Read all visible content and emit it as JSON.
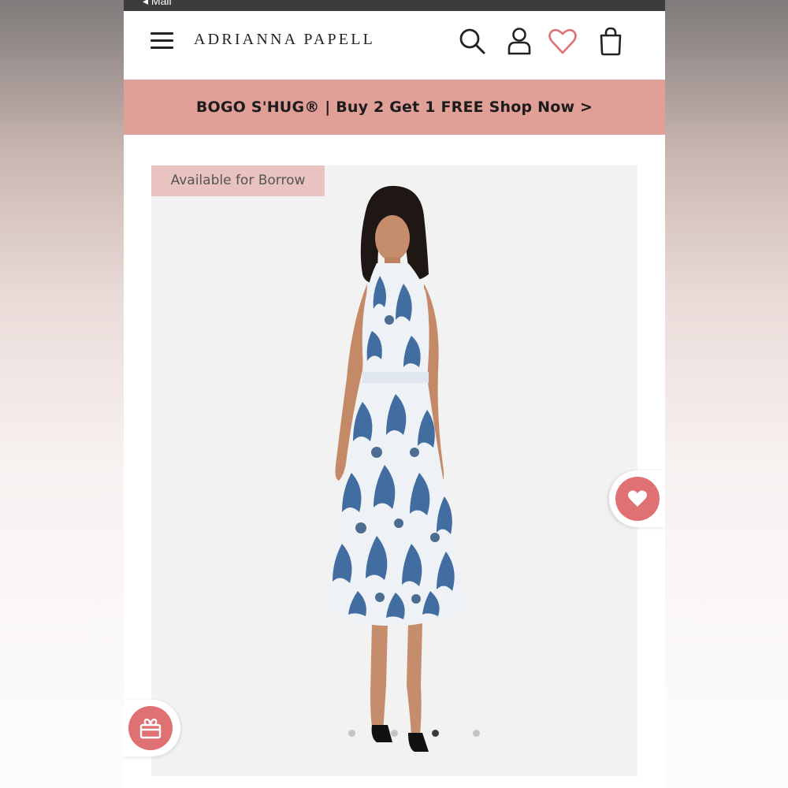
{
  "status_bar": {
    "back_label": "◂ Mail"
  },
  "header": {
    "brand": "ADRIANNA PAPELL",
    "icons": [
      "menu-icon",
      "search-icon",
      "account-icon",
      "wishlist-heart-icon",
      "shopping-bag-icon"
    ]
  },
  "promo": {
    "text": "BOGO S'HUG® | Buy 2 Get 1 FREE Shop Now >"
  },
  "product": {
    "badge": "Available for Borrow",
    "image_carousel": {
      "total_dots": 4,
      "active_index": 2
    }
  },
  "floating": {
    "favorite_icon": "heart-icon",
    "gift_icon": "gift-icon"
  },
  "colors": {
    "promo_bg": "#e09f97",
    "badge_bg": "#e8c3bf",
    "accent": "#e07173",
    "heart_outline": "#e07173",
    "dress_blue": "#2f5f97",
    "panel_bg": "#f3f2f2"
  }
}
